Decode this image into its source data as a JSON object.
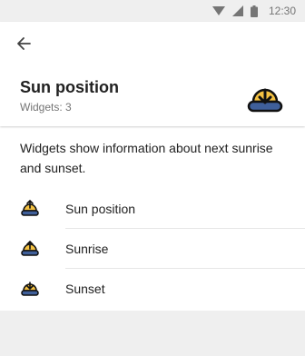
{
  "status_bar": {
    "time": "12:30",
    "icons": [
      "wifi-icon",
      "signal-icon",
      "battery-icon"
    ]
  },
  "header": {
    "back_icon": "arrow-back-icon",
    "title": "Sun position",
    "subtitle": "Widgets: 3",
    "icon": "sunset-icon",
    "icon_colors": {
      "sun": "#f5c242",
      "base": "#3f5f9a",
      "outline": "#111111"
    }
  },
  "description": "Widgets show information about next sunrise and sunset.",
  "widgets": [
    {
      "label": "Sun position",
      "icon": "sun-position-icon"
    },
    {
      "label": "Sunrise",
      "icon": "sunrise-icon"
    },
    {
      "label": "Sunset",
      "icon": "sunset-icon"
    }
  ]
}
